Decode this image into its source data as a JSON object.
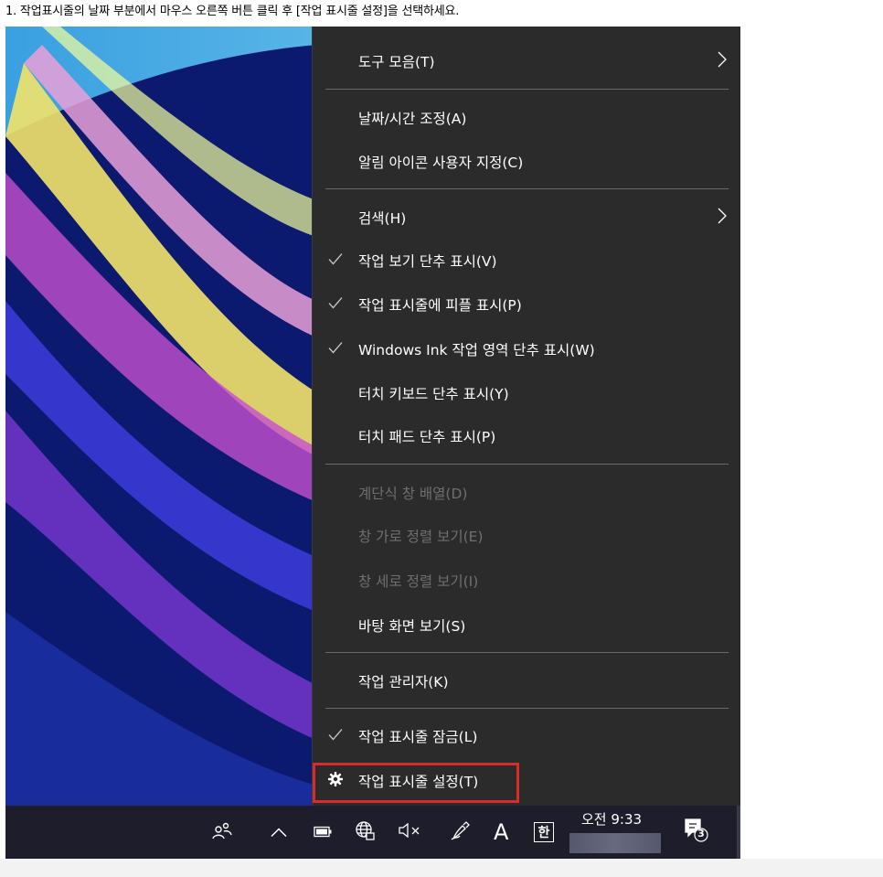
{
  "caption": "1. 작업표시줄의 날짜 부분에서 마우스 오른쪽 버튼 클릭 후 [작업 표시줄 설정]을 선택하세요.",
  "menu": {
    "toolbars": "도구 모음(T)",
    "adjust_date_time": "날짜/시간 조정(A)",
    "customize_notification_icons": "알림 아이콘 사용자 지정(C)",
    "search": "검색(H)",
    "show_task_view": "작업 보기 단추 표시(V)",
    "show_people": "작업 표시줄에 피플 표시(P)",
    "show_windows_ink": "Windows Ink 작업 영역 단추 표시(W)",
    "show_touch_keyboard": "터치 키보드 단추 표시(Y)",
    "show_touchpad": "터치 패드 단추 표시(P)",
    "cascade_windows": "계단식 창 배열(D)",
    "show_stacked": "창 가로 정렬 보기(E)",
    "show_side_by_side": "창 세로 정렬 보기(I)",
    "show_desktop": "바탕 화면 보기(S)",
    "task_manager": "작업 관리자(K)",
    "lock_taskbar": "작업 표시줄 잠금(L)",
    "taskbar_settings": "작업 표시줄 설정(T)"
  },
  "taskbar": {
    "ime_letter": "A",
    "ime_hangul": "한",
    "clock": "오전 9:33",
    "notification_count": "3"
  },
  "colors": {
    "menu_bg": "#2b2b2b",
    "highlight": "#d92b2b",
    "taskbar_bg": "#1d1d2b"
  }
}
